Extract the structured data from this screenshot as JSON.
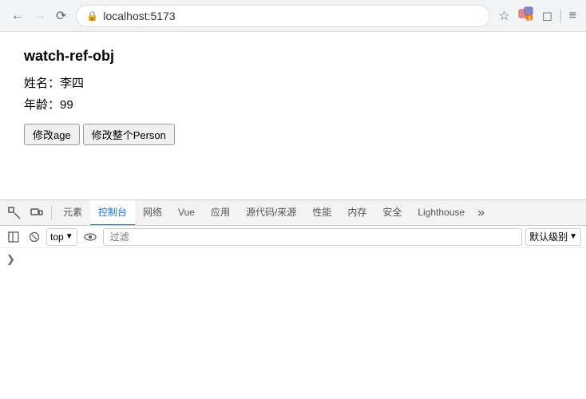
{
  "browser": {
    "url": "localhost:5173",
    "back_disabled": false,
    "forward_disabled": true,
    "reload_label": "↻",
    "star_icon": "☆",
    "secure_icon": "🔒"
  },
  "page": {
    "title": "watch-ref-obj",
    "name_label": "姓名：",
    "name_value": "李四",
    "age_label": "年龄：",
    "age_value": "99",
    "btn_modify_age": "修改age",
    "btn_modify_person": "修改整个Person"
  },
  "devtools": {
    "tabs": [
      {
        "id": "elements",
        "label": "元素",
        "active": false
      },
      {
        "id": "console",
        "label": "控制台",
        "active": true
      },
      {
        "id": "network",
        "label": "网络",
        "active": false
      },
      {
        "id": "vue",
        "label": "Vue",
        "active": false
      },
      {
        "id": "application",
        "label": "应用",
        "active": false
      },
      {
        "id": "sources",
        "label": "源代码/来源",
        "active": false
      },
      {
        "id": "performance",
        "label": "性能",
        "active": false
      },
      {
        "id": "memory",
        "label": "内存",
        "active": false
      },
      {
        "id": "security",
        "label": "安全",
        "active": false
      },
      {
        "id": "lighthouse",
        "label": "Lighthouse",
        "active": false
      }
    ],
    "toolbar": {
      "top_selector_label": "top",
      "filter_placeholder": "过滤",
      "log_level_label": "默认级别"
    }
  }
}
